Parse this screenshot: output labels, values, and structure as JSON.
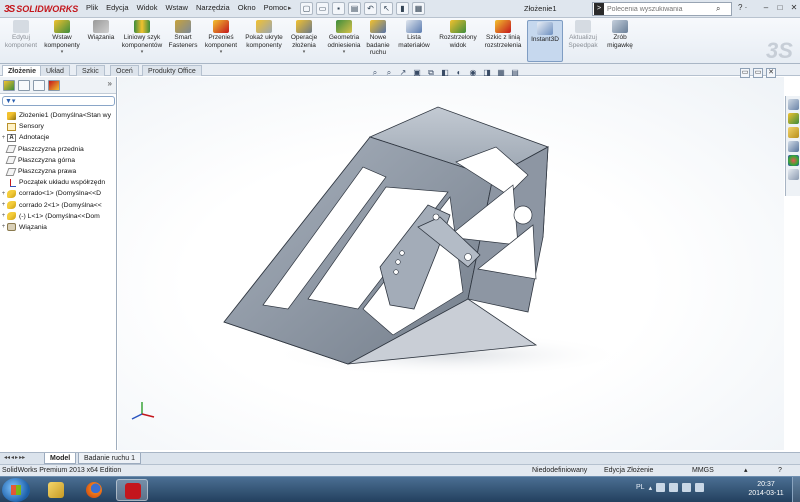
{
  "app": {
    "logo_text": "SOLIDWORKS",
    "logo_mark": "3S",
    "document_title": "Złożenie1",
    "brand_watermark": "3S"
  },
  "menu": [
    "Plik",
    "Edycja",
    "Widok",
    "Wstaw",
    "Narzędzia",
    "Okno",
    "Pomoc"
  ],
  "menu_arrow": "▸",
  "search": {
    "placeholder": "Polecenia wyszukiwania",
    "prompt": ">",
    "icon": "magnifier-icon"
  },
  "help_icon_text": "? ·",
  "window_controls": [
    "–",
    "□",
    "✕"
  ],
  "ribbon": [
    {
      "label": "Edytuj komponent",
      "icon": "edit-component-icon",
      "disabled": true,
      "dropdown": false
    },
    {
      "label": "Wstaw komponenty",
      "icon": "insert-components-icon",
      "disabled": false,
      "dropdown": true
    },
    {
      "label": "Wiązania",
      "icon": "mate-icon",
      "disabled": false,
      "dropdown": false
    },
    {
      "label": "Liniowy szyk komponentów",
      "icon": "linear-pattern-icon",
      "disabled": false,
      "dropdown": true
    },
    {
      "label": "Smart Fasteners",
      "icon": "smart-fasteners-icon",
      "disabled": false,
      "dropdown": false
    },
    {
      "label": "Przenieś komponent",
      "icon": "move-component-icon",
      "disabled": false,
      "dropdown": true
    },
    {
      "label": "Pokaż ukryte komponenty",
      "icon": "show-hidden-icon",
      "disabled": false,
      "dropdown": false
    },
    {
      "label": "Operacje złożenia",
      "icon": "assembly-features-icon",
      "disabled": false,
      "dropdown": true
    },
    {
      "label": "Geometria odniesienia",
      "icon": "reference-geometry-icon",
      "disabled": false,
      "dropdown": true
    },
    {
      "label": "Nowe badanie ruchu",
      "icon": "motion-study-icon",
      "disabled": false,
      "dropdown": false
    },
    {
      "label": "Lista materiałów",
      "icon": "bom-icon",
      "disabled": false,
      "dropdown": false
    },
    {
      "label": "Rozstrzelony widok",
      "icon": "exploded-view-icon",
      "disabled": false,
      "dropdown": false
    },
    {
      "label": "Szkic z linią rozstrzelenia",
      "icon": "explode-line-sketch-icon",
      "disabled": false,
      "dropdown": false
    },
    {
      "label": "Instant3D",
      "icon": "instant3d-icon",
      "disabled": false,
      "dropdown": false,
      "active": true
    },
    {
      "label": "Aktualizuj Speedpak",
      "icon": "speedpak-icon",
      "disabled": true,
      "dropdown": false
    },
    {
      "label": "Zrób migawkę",
      "icon": "snapshot-icon",
      "disabled": false,
      "dropdown": false
    }
  ],
  "manager_tabs": [
    "Złożenie",
    "Układ",
    "Szkic",
    "Oceń",
    "Produkty Office"
  ],
  "panel": {
    "more": "»",
    "filter_icon": "▼▾"
  },
  "tree": [
    {
      "label": "Złożenie1  (Domyślna<Stan wy",
      "icon": "asm",
      "expander": ""
    },
    {
      "label": "Sensory",
      "icon": "sens",
      "expander": ""
    },
    {
      "label": "Adnotacje",
      "icon": "ann",
      "expander": "+"
    },
    {
      "label": "Płaszczyzna przednia",
      "icon": "plane",
      "expander": ""
    },
    {
      "label": "Płaszczyzna górna",
      "icon": "plane",
      "expander": ""
    },
    {
      "label": "Płaszczyzna prawa",
      "icon": "plane",
      "expander": ""
    },
    {
      "label": "Początek układu współrzędn",
      "icon": "orig",
      "expander": ""
    },
    {
      "label": "corrado<1> (Domyślna<<D",
      "icon": "part",
      "expander": "+"
    },
    {
      "label": "corrado 2<1> (Domyślna<<",
      "icon": "part",
      "expander": "+"
    },
    {
      "label": "(-) L<1> (Domyślna<<Dom",
      "icon": "part",
      "expander": "+"
    },
    {
      "label": "Wiązania",
      "icon": "mate",
      "expander": "+"
    }
  ],
  "splitter_glyph": "⋮",
  "heads_up": [
    "⌕",
    "⌕",
    "↗",
    "▣",
    "⧉",
    "◧",
    "◐",
    "◉",
    "◨",
    "▦",
    "▤"
  ],
  "viewport_window": [
    "▭",
    "▭",
    "✕"
  ],
  "taskpane_icons": [
    "home-icon",
    "design-library-icon",
    "file-explorer-icon",
    "view-palette-icon",
    "appearances-icon",
    "custom-props-icon"
  ],
  "bottom_tabs": [
    "Model",
    "Badanie ruchu 1"
  ],
  "nav_arrows": [
    "◂◂",
    "◂",
    "▸",
    "▸▸"
  ],
  "status": {
    "edition": "SolidWorks Premium 2013 x64 Edition",
    "definition": "Niedodefiniowany",
    "mode": "Edycja Złożenie",
    "units": "MMGS",
    "units_arrow": "▴",
    "help": "?"
  },
  "taskbar": {
    "apps": [
      "explorer-icon",
      "firefox-icon",
      "solidworks-icon"
    ],
    "locale": "PL",
    "time": "20:37",
    "date": "2014-03-11"
  },
  "colors": {
    "brand_red": "#c4161c",
    "ribbon_bg": "#eef2f6",
    "part_fill": "#8a94a2",
    "part_edge": "#2f3640",
    "active_tab": "#c6d8ee"
  }
}
